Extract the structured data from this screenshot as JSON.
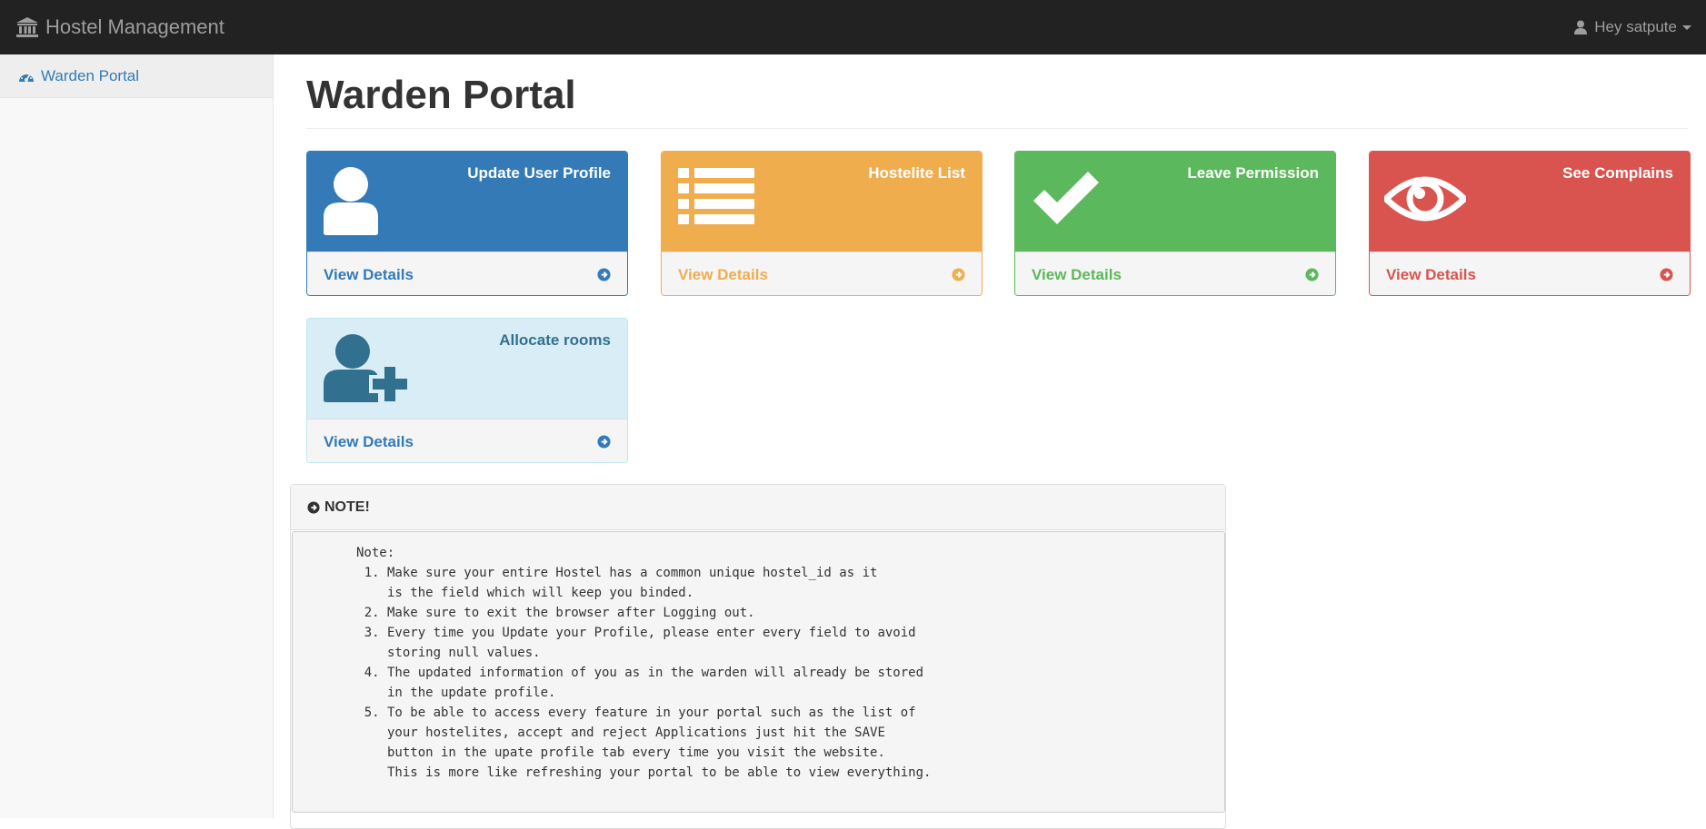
{
  "navbar": {
    "brand": "Hostel Management",
    "brand_icon": "institution-icon",
    "user_label": "Hey satpute",
    "user_icon": "user-icon"
  },
  "sidebar": {
    "items": [
      {
        "label": "Warden Portal",
        "icon": "dashboard-icon"
      }
    ]
  },
  "main": {
    "title": "Warden Portal",
    "panels": [
      {
        "title": "Update User Profile",
        "link": "View Details",
        "icon": "user-icon",
        "color": "#337ab7"
      },
      {
        "title": "Hostelite List",
        "link": "View Details",
        "icon": "list-icon",
        "color": "#f0ad4e"
      },
      {
        "title": "Leave Permission",
        "link": "View Details",
        "icon": "checkmark-icon",
        "color": "#5cb85c"
      },
      {
        "title": "See Complains",
        "link": "View Details",
        "icon": "eye-icon",
        "color": "#d9534f"
      },
      {
        "title": "Allocate rooms",
        "link": "View Details",
        "icon": "user-plus-icon",
        "color": "#31708f"
      }
    ],
    "note": {
      "heading": "NOTE!",
      "label": "Note:",
      "items": [
        "Make sure your entire Hostel has a common unique hostel_id as it\nis the field which will keep you binded.",
        "Make sure to exit the browser after Logging out.",
        "Every time you Update your Profile, please enter every field to avoid\nstoring null values.",
        "The updated information of you as in the warden will already be stored\nin the update profile.",
        "To be able to access every feature in your portal such as the list of\nyour hostelites, accept and reject Applications just hit the SAVE\nbutton in the upate profile tab every time you visit the website.\nThis is more like refreshing your portal to be able to view everything."
      ]
    }
  }
}
